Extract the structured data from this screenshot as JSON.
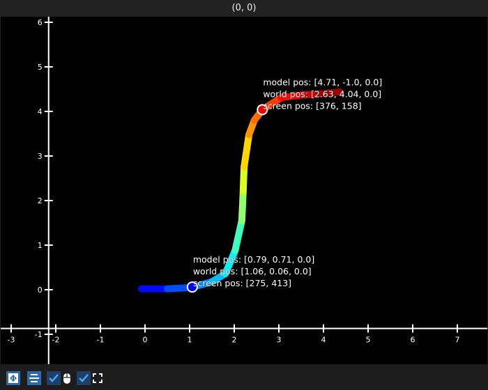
{
  "window": {
    "title": "(0, 0)"
  },
  "plot": {
    "x_ticks": [
      "-3",
      "-2",
      "-1",
      "0",
      "1",
      "2",
      "3",
      "4",
      "5",
      "6",
      "7"
    ],
    "x_tick_values": [
      -3,
      -2,
      -1,
      0,
      1,
      2,
      3,
      4,
      5,
      6,
      7
    ],
    "y_ticks": [
      "-1",
      "0",
      "1",
      "2",
      "3",
      "4",
      "5",
      "6"
    ],
    "y_tick_values": [
      -1,
      0,
      1,
      2,
      3,
      4,
      5,
      6
    ],
    "curve_world_points": [
      [
        -0.08,
        0.02
      ],
      [
        0.5,
        0.02
      ],
      [
        1.05,
        0.05
      ],
      [
        1.5,
        0.18
      ],
      [
        1.8,
        0.36
      ],
      [
        2.02,
        0.88
      ],
      [
        2.17,
        1.55
      ],
      [
        2.2,
        2.2
      ],
      [
        2.22,
        2.75
      ],
      [
        2.33,
        3.48
      ],
      [
        2.45,
        3.8
      ],
      [
        2.63,
        4.04
      ],
      [
        3.05,
        4.31
      ],
      [
        3.5,
        4.37
      ],
      [
        3.89,
        4.39
      ],
      [
        4.36,
        4.44
      ]
    ],
    "colormap": "jet",
    "markers": [
      {
        "world": [
          1.06,
          0.06
        ],
        "fill": "#0000ee",
        "lines": [
          "model pos: [0.79, 0.71, 0.0]",
          "world pos: [1.06, 0.06, 0.0]",
          "screen pos: [275, 413]"
        ]
      },
      {
        "world": [
          2.63,
          4.04
        ],
        "fill": "#ee0000",
        "lines": [
          "model pos: [4.71, -1.0, 0.0]",
          "world pos: [2.63, 4.04, 0.0]",
          "screen pos: [376, 158]"
        ]
      }
    ]
  },
  "toolbar": {
    "buttons": [
      {
        "icon": "fit-view-icon",
        "style": "blue"
      },
      {
        "icon": "align-center-icon",
        "style": "blue"
      },
      {
        "icon": "checkbox-checked-icon",
        "style": "check",
        "label_icon": "mouse-icon"
      },
      {
        "icon": "checkbox-checked-icon",
        "style": "check",
        "label_icon": "fullscreen-icon"
      }
    ]
  }
}
